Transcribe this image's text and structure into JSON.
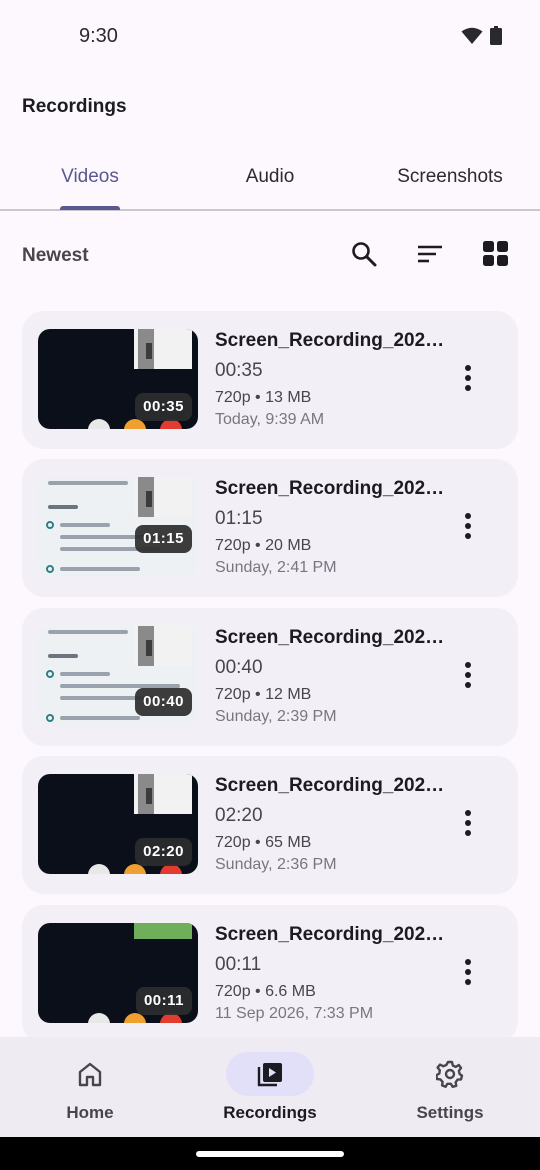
{
  "status_bar": {
    "time": "9:30"
  },
  "app_bar": {
    "title": "Recordings"
  },
  "tabs": [
    {
      "label": "Videos",
      "active": true
    },
    {
      "label": "Audio",
      "active": false
    },
    {
      "label": "Screenshots",
      "active": false
    }
  ],
  "filter": {
    "sort_label": "Newest",
    "icons": [
      "search-icon",
      "sort-icon",
      "grid-view-icon"
    ]
  },
  "recordings": [
    {
      "title": "Screen_Recording_202…",
      "duration": "00:35",
      "meta": "720p • 13 MB",
      "date": "Today, 9:39 AM",
      "thumb_style": "dark"
    },
    {
      "title": "Screen_Recording_202…",
      "duration": "01:15",
      "meta": "720p • 20 MB",
      "date": "Sunday, 2:41 PM",
      "thumb_style": "light"
    },
    {
      "title": "Screen_Recording_202…",
      "duration": "00:40",
      "meta": "720p • 12 MB",
      "date": "Sunday, 2:39 PM",
      "thumb_style": "light"
    },
    {
      "title": "Screen_Recording_202…",
      "duration": "02:20",
      "meta": "720p • 65 MB",
      "date": "Sunday, 2:36 PM",
      "thumb_style": "dark"
    },
    {
      "title": "Screen_Recording_202…",
      "duration": "00:11",
      "meta": "720p • 6.6 MB",
      "date": "11 Sep 2026, 7:33 PM",
      "thumb_style": "dark"
    }
  ],
  "bottom_nav": [
    {
      "label": "Home",
      "icon": "home-icon",
      "active": false
    },
    {
      "label": "Recordings",
      "icon": "video-library-icon",
      "active": true
    },
    {
      "label": "Settings",
      "icon": "gear-icon",
      "active": false
    }
  ],
  "colors": {
    "accent": "#5a5791",
    "background": "#fcf8fe",
    "card": "#f3eff6",
    "nav_active_pill": "#e2dff8"
  }
}
